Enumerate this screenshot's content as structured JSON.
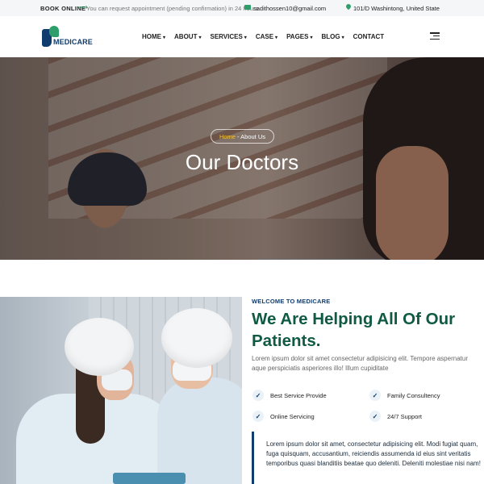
{
  "topbar": {
    "book_label": "BOOK ONLINE",
    "arrow": "⟶",
    "note": "You can request appointment (pending confirmation) in 24 hours",
    "email": "sadithossen10@gmail.com",
    "address": "101/D Washintong, United State"
  },
  "header": {
    "logo_text": "MEDICARE",
    "nav": [
      {
        "label": "HOME",
        "caret": "▾"
      },
      {
        "label": "ABOUT",
        "caret": "▾"
      },
      {
        "label": "SERVICES",
        "caret": "▾"
      },
      {
        "label": "CASE",
        "caret": "▾"
      },
      {
        "label": "PAGES",
        "caret": "▾"
      },
      {
        "label": "BLOG",
        "caret": "▾"
      },
      {
        "label": "CONTACT",
        "caret": ""
      }
    ]
  },
  "hero": {
    "breadcrumb_home": "Home",
    "breadcrumb_rest": "- About Us",
    "title": "Our Doctors"
  },
  "about": {
    "eyebrow": "WELCOME TO MEDICARE",
    "title": "We Are Helping All Of Our Patients.",
    "lead": "Lorem ipsum dolor sit amet consectetur adipisicing elit. Tempore aspernatur aque perspiciatis asperiores illo! Illum cupiditate",
    "features": [
      {
        "check": "✓",
        "label": "Best Service Provide"
      },
      {
        "check": "✓",
        "label": "Family Consultency"
      },
      {
        "check": "✓",
        "label": "Online Servicing"
      },
      {
        "check": "✓",
        "label": "24/7 Support"
      }
    ],
    "quote": "Lorem ipsum dolor sit amet, consectetur adipisicing elit. Modi fugiat quam, fuga quisquam, accusantium, reiciendis assumenda id eius sint veritatis temporibus quasi blanditiis beatae quo deleniti. Deleniti molestiae nisi nam!"
  },
  "colors": {
    "brand_navy": "#0f3d6e",
    "brand_green": "#0e5a43",
    "accent_yellow": "#f6c02d",
    "accent_teal": "#2e9e6a"
  }
}
